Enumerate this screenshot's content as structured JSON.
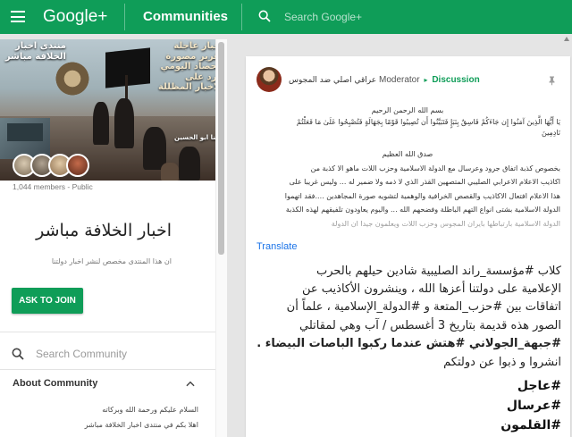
{
  "topbar": {
    "brand": "Google+",
    "section": "Communities",
    "search_placeholder": "Search Google+"
  },
  "community": {
    "cover_caption_left": "منتدى اخبار الخلافة مباشر",
    "cover_caption_right": "اخبار عاجلة\nتقرير مصورة\nالحصاد اليومي\nالرد على\nالاخبار المظللة",
    "cover_caption_small": "كلنا ابو الحسين",
    "members": "1,044 members - Public",
    "name": "اخبار الخلافة مباشر",
    "tagline": "ان هذا المنتدى مخصص لنشر اخبار دولتنا",
    "join_label": "ASK TO JOIN",
    "search_placeholder": "Search Community",
    "about_header": "About Community",
    "about_line1": "السلام عليكم ورحمة الله وبركاته",
    "about_line2": "اهلا بكم في منتدى اخبار الخلافة مباشر"
  },
  "post": {
    "author": "عراقي اصلي ضد المجوس",
    "role": "Moderator",
    "category": "Discussion",
    "basmala": "بسم الله الرحمن الرحيم",
    "verse": "يَا أَيُّهَا الَّذِينَ آمَنُوا إِن جَاءَكُمْ فَاسِقٌ بِنَبَإٍ فَتَبَيَّنُوا أَن تُصِيبُوا قَوْمًا بِجَهَالَةٍ فَتُصْبِحُوا عَلَىٰ مَا فَعَلْتُمْ",
    "verse_end": "نَادِمِينَ",
    "sadaqa": "صدق الله العظيم",
    "para1": "بخصوص كذبة اتفاق جرود وعرسال مع الدولة الاسلامية وحزب اللات ماهو الا كذبة من",
    "para2": "اكاذيب الاعلام الاعرابي الصليبي المتصهين القذر الذي لا ذمه ولا ضمير له ... وليس غريبا على",
    "para3": "هذا الاعلام افتعال الاكاذيب والقصص الخرافية والوهمية لتشويه صورة المجاهدين ....فقد اتهموا",
    "para4": "الدولة الاسلامية بشتى انواع التهم الباطلة وفضحهم الله ... واليوم يعاودون تلفيقهم لهذه الكذبة",
    "para5": "الدولة الاسلامية بارتباطها بايران المجوس وحزب اللات ويعلمون جيدا ان الدولة",
    "translate": "Translate",
    "line1": "كلاب #مؤسسة_راند الصليبية شادين حيلهم بالحرب",
    "line2": "الإعلامية على دولتنا أعزها الله ، وينشرون الأكاذيب عن",
    "line3": "اتفاقات بين #حزب_المتعة و #الدولة_الإسلامية ، علماً أن",
    "line4": "الصور هذه قديمة بتاريخ 3 أغسطس / آب وهي لمقاتلي",
    "line5": "#جبهة_الجولاني #هتش عندما ركبوا الباصات البيضاء .",
    "line6": "انشروا و ذبوا عن دولتكم",
    "tags": [
      "#عاجل",
      "#عرسال",
      "#القلمون"
    ]
  },
  "colors": {
    "brand_green": "#0f9d58",
    "link_blue": "#1a73e8",
    "page_bg": "#e5e5e5"
  },
  "icons": [
    "menu-icon",
    "search-icon",
    "expand-less-icon",
    "pin-icon",
    "arrow-right-icon"
  ]
}
